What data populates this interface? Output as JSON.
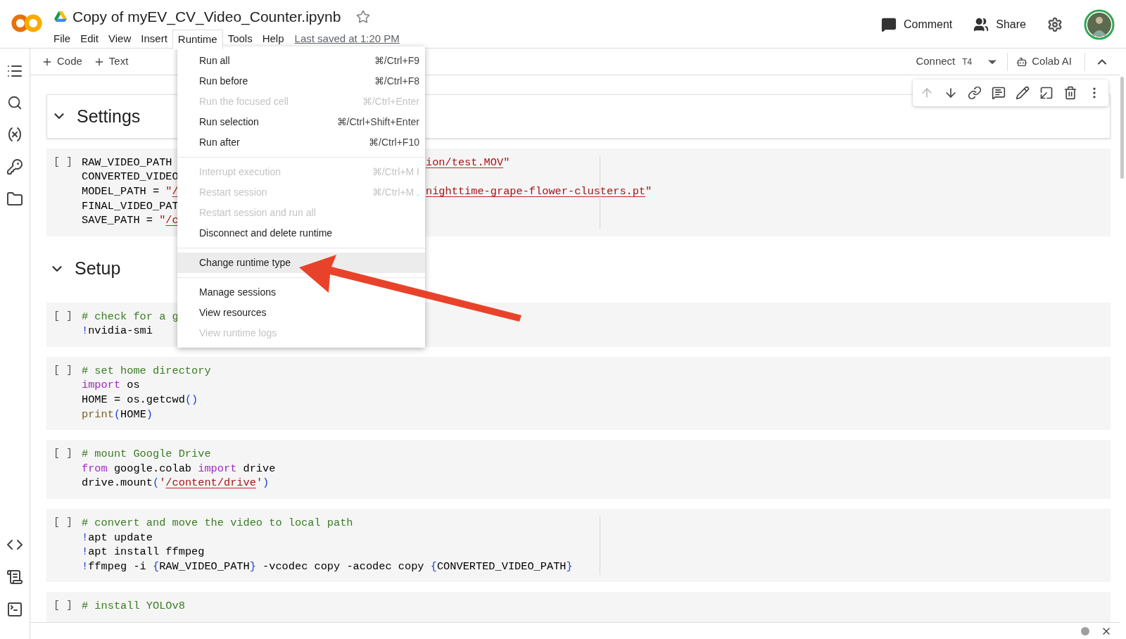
{
  "header": {
    "title": "Copy of myEV_CV_Video_Counter.ipynb",
    "starred": false,
    "menus": [
      {
        "label": "File",
        "selected": false
      },
      {
        "label": "Edit",
        "selected": false
      },
      {
        "label": "View",
        "selected": false
      },
      {
        "label": "Insert",
        "selected": false
      },
      {
        "label": "Runtime",
        "selected": true
      },
      {
        "label": "Tools",
        "selected": false
      },
      {
        "label": "Help",
        "selected": false
      }
    ],
    "last_saved": "Last saved at 1:20 PM",
    "actions": [
      {
        "kind": "comment",
        "label": "Comment"
      },
      {
        "kind": "share",
        "label": "Share"
      }
    ]
  },
  "toolbar": {
    "add": [
      "Code",
      "Text"
    ],
    "connect": "Connect",
    "accelerator": "T4",
    "ai": "Colab AI"
  },
  "cells": [
    {
      "kind": "heading",
      "title": "Settings",
      "expanded": true
    },
    {
      "kind": "code",
      "run": "[ ]",
      "ruler": true,
      "lines": [
        {
          "left": [
            {
              "kind": "plain",
              "text": "RAW_VIDEO_PATH"
            }
          ],
          "right": [
            {
              "kind": "string",
              "text": "ion/test.MOV"
            },
            {
              "kind": "plain_string",
              "text": "\""
            }
          ]
        },
        {
          "left": [
            {
              "kind": "plain",
              "text": "CONVERTED_VIDEO"
            }
          ]
        },
        {
          "left": [
            {
              "kind": "plain",
              "text": "MODEL_PATH = "
            },
            {
              "kind": "plain_string",
              "text": "\""
            },
            {
              "kind": "string",
              "text": "/"
            }
          ],
          "right": [
            {
              "kind": "string",
              "text": "nighttime-grape-flower-clusters.pt"
            },
            {
              "kind": "plain_string",
              "text": "\""
            }
          ]
        },
        {
          "left": [
            {
              "kind": "plain",
              "text": "FINAL_VIDEO_PAT"
            }
          ]
        },
        {
          "left": [
            {
              "kind": "plain",
              "text": "SAVE_PATH = "
            },
            {
              "kind": "plain_string",
              "text": "\""
            },
            {
              "kind": "string",
              "text": "/c"
            }
          ]
        }
      ]
    },
    {
      "kind": "heading",
      "title": "Setup",
      "expanded": true
    },
    {
      "kind": "code",
      "run": "[ ]",
      "ruler": false,
      "lines": [
        {
          "left": [
            {
              "kind": "comment",
              "text": "# check for a g"
            }
          ]
        },
        {
          "left": [
            {
              "kind": "bang",
              "text": "!"
            },
            {
              "kind": "plain",
              "text": "nvidia-smi"
            }
          ]
        }
      ]
    },
    {
      "kind": "code",
      "run": "[ ]",
      "ruler": false,
      "lines": [
        {
          "left": [
            {
              "kind": "comment",
              "text": "# set home directory"
            }
          ]
        },
        {
          "left": [
            {
              "kind": "keyword",
              "text": "import"
            },
            {
              "kind": "plain",
              "text": " os"
            }
          ]
        },
        {
          "left": [
            {
              "kind": "plain",
              "text": "HOME = os.getcwd"
            },
            {
              "kind": "bracket",
              "text": "()"
            }
          ]
        },
        {
          "left": [
            {
              "kind": "builtin",
              "text": "print"
            },
            {
              "kind": "bracket",
              "text": "("
            },
            {
              "kind": "plain",
              "text": "HOME"
            },
            {
              "kind": "bracket",
              "text": ")"
            }
          ]
        }
      ]
    },
    {
      "kind": "code",
      "run": "[ ]",
      "ruler": false,
      "lines": [
        {
          "left": [
            {
              "kind": "comment",
              "text": "# mount Google Drive"
            }
          ]
        },
        {
          "left": [
            {
              "kind": "keyword",
              "text": "from"
            },
            {
              "kind": "plain",
              "text": " google.colab "
            },
            {
              "kind": "keyword",
              "text": "import"
            },
            {
              "kind": "plain",
              "text": " drive"
            }
          ]
        },
        {
          "left": [
            {
              "kind": "plain",
              "text": "drive.mount"
            },
            {
              "kind": "bracket",
              "text": "("
            },
            {
              "kind": "plain_string",
              "text": "'"
            },
            {
              "kind": "string",
              "text": "/content/drive"
            },
            {
              "kind": "plain_string",
              "text": "'"
            },
            {
              "kind": "bracket",
              "text": ")"
            }
          ]
        }
      ]
    },
    {
      "kind": "code",
      "run": "[ ]",
      "ruler": true,
      "lines": [
        {
          "left": [
            {
              "kind": "comment",
              "text": "# convert and move the video to local path"
            }
          ]
        },
        {
          "left": [
            {
              "kind": "bang",
              "text": "!"
            },
            {
              "kind": "plain",
              "text": "apt update"
            }
          ]
        },
        {
          "left": [
            {
              "kind": "bang",
              "text": "!"
            },
            {
              "kind": "plain",
              "text": "apt install ffmpeg"
            }
          ]
        },
        {
          "left": [
            {
              "kind": "bang",
              "text": "!"
            },
            {
              "kind": "plain",
              "text": "ffmpeg -i "
            },
            {
              "kind": "bracket",
              "text": "{"
            },
            {
              "kind": "plain",
              "text": "RAW_VIDEO_PATH"
            },
            {
              "kind": "bracket",
              "text": "}"
            },
            {
              "kind": "plain",
              "text": " -vcodec copy -acodec copy "
            },
            {
              "kind": "bracket",
              "text": "{"
            },
            {
              "kind": "plain",
              "text": "CONVERTED_VIDEO_PATH"
            },
            {
              "kind": "bracket",
              "text": "}"
            }
          ]
        }
      ]
    },
    {
      "kind": "code",
      "run": "[ ]",
      "ruler": false,
      "lines": [
        {
          "left": [
            {
              "kind": "comment",
              "text": "# install YOLOv8"
            }
          ]
        }
      ]
    }
  ],
  "menu": {
    "items": [
      {
        "kind": "item",
        "label": "Run all",
        "shortcut": "⌘/Ctrl+F9",
        "disabled": false,
        "selected": false
      },
      {
        "kind": "item",
        "label": "Run before",
        "shortcut": "⌘/Ctrl+F8",
        "disabled": false,
        "selected": false
      },
      {
        "kind": "item",
        "label": "Run the focused cell",
        "shortcut": "⌘/Ctrl+Enter",
        "disabled": true,
        "selected": false
      },
      {
        "kind": "item",
        "label": "Run selection",
        "shortcut": "⌘/Ctrl+Shift+Enter",
        "disabled": false,
        "selected": false
      },
      {
        "kind": "item",
        "label": "Run after",
        "shortcut": "⌘/Ctrl+F10",
        "disabled": false,
        "selected": false
      },
      {
        "kind": "divider"
      },
      {
        "kind": "item",
        "label": "Interrupt execution",
        "shortcut": "⌘/Ctrl+M I",
        "disabled": true,
        "selected": false
      },
      {
        "kind": "item",
        "label": "Restart session",
        "shortcut": "⌘/Ctrl+M .",
        "disabled": true,
        "selected": false
      },
      {
        "kind": "item",
        "label": "Restart session and run all",
        "disabled": true,
        "selected": false
      },
      {
        "kind": "item",
        "label": "Disconnect and delete runtime",
        "disabled": false,
        "selected": false
      },
      {
        "kind": "divider"
      },
      {
        "kind": "item",
        "label": "Change runtime type",
        "disabled": false,
        "selected": true
      },
      {
        "kind": "divider"
      },
      {
        "kind": "item",
        "label": "Manage sessions",
        "disabled": false,
        "selected": false
      },
      {
        "kind": "item",
        "label": "View resources",
        "disabled": false,
        "selected": false
      },
      {
        "kind": "item",
        "label": "View runtime logs",
        "disabled": true,
        "selected": false
      }
    ]
  }
}
